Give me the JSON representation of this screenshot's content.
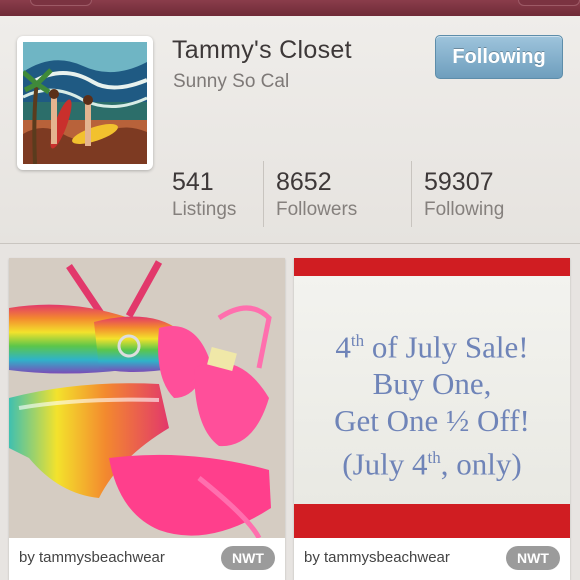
{
  "profile": {
    "name": "Tammy's Closet",
    "location": "Sunny So Cal",
    "follow_button": "Following",
    "stats": [
      {
        "value": "541",
        "label": "Listings"
      },
      {
        "value": "8652",
        "label": "Followers"
      },
      {
        "value": "59307",
        "label": "Following"
      }
    ]
  },
  "listings": [
    {
      "seller_line": "by tammysbeachwear",
      "badge": "NWT",
      "image": "rainbow-and-pink-bikinis-photo"
    },
    {
      "seller_line": "by tammysbeachwear",
      "badge": "NWT",
      "image": "sale-sign-photo",
      "sign": {
        "line1_pre": "4",
        "line1_sup": "th",
        "line1_post": " of July Sale!",
        "line2": "Buy One,",
        "line3": "Get One ½ Off!",
        "line4_pre": "(July 4",
        "line4_sup": "th",
        "line4_post": ", only)"
      }
    }
  ],
  "colors": {
    "follow_button": "#7fadc9",
    "topbar": "#7b3341",
    "sign_text": "#6f84b8",
    "sign_border": "#d01d22",
    "badge": "#9b9b9b"
  }
}
